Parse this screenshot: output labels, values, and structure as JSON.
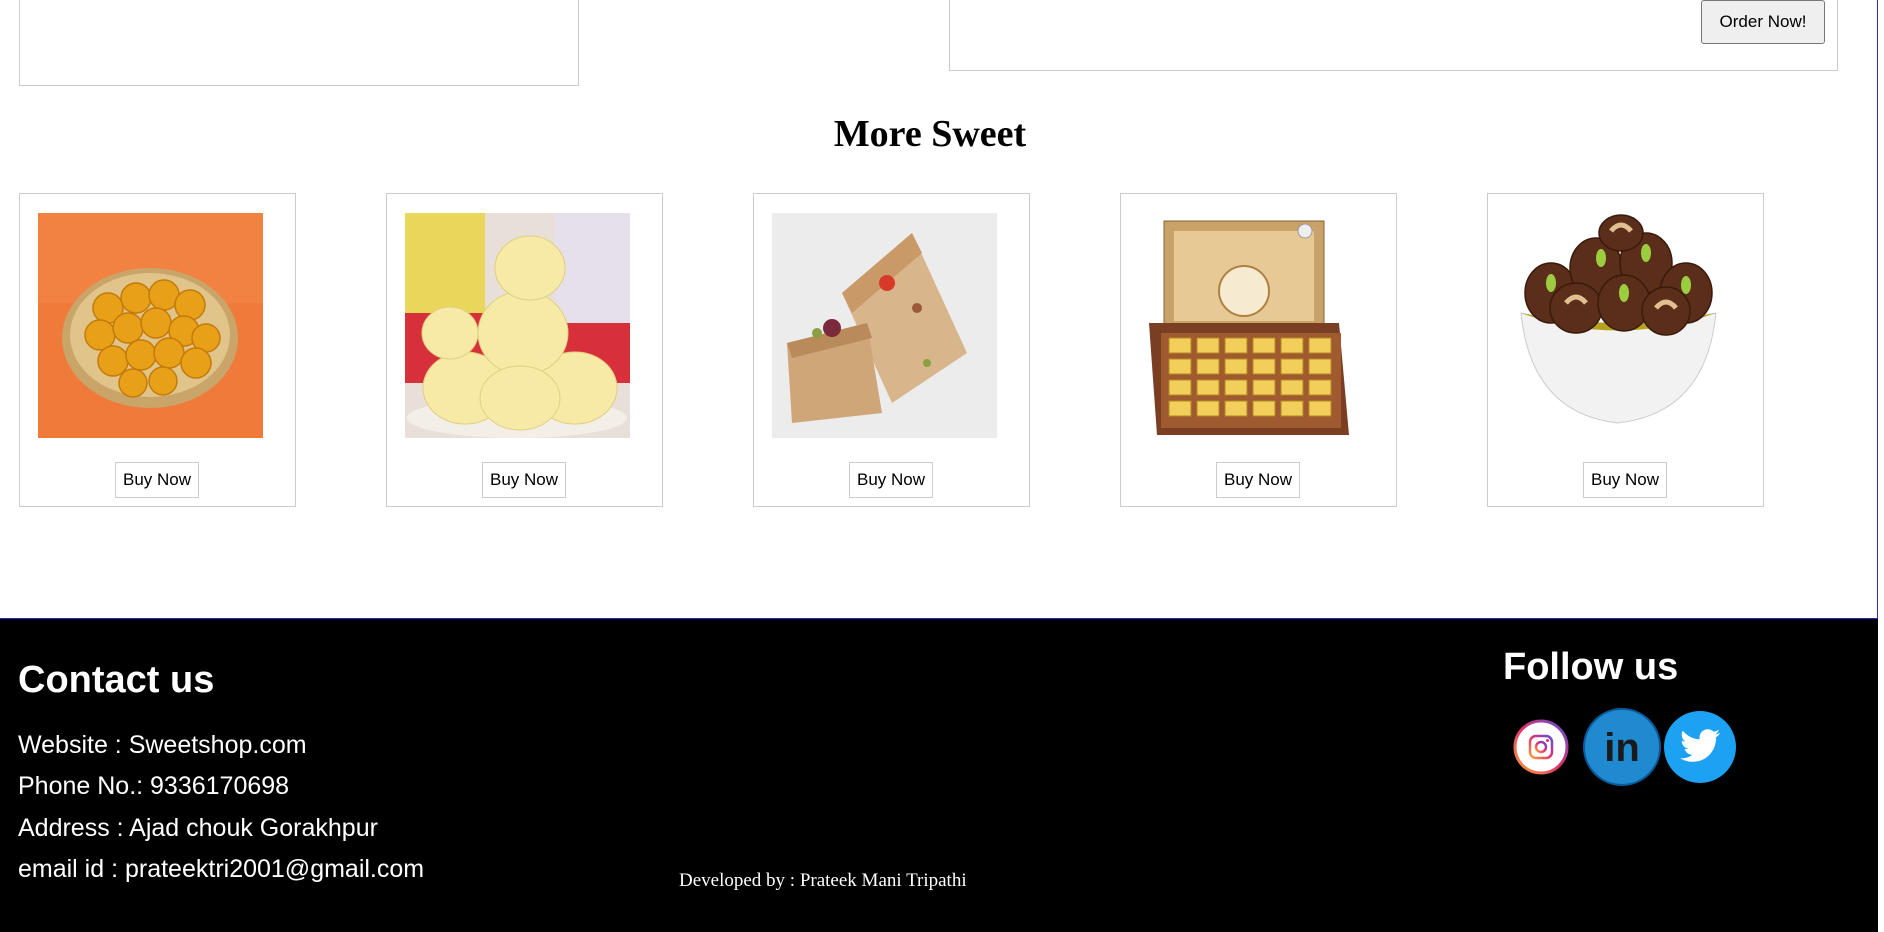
{
  "order_button": {
    "label": "Order Now!"
  },
  "more_sweet": {
    "title": "More Sweet",
    "items": [
      {
        "name": "laddu",
        "button": "Buy Now"
      },
      {
        "name": "rasgulla",
        "button": "Buy Now"
      },
      {
        "name": "milk-cake",
        "button": "Buy Now"
      },
      {
        "name": "chocolate-box",
        "button": "Buy Now"
      },
      {
        "name": "dry-fruit-sweets",
        "button": "Buy Now"
      }
    ]
  },
  "footer": {
    "contact_title": "Contact us",
    "website": "Website : Sweetshop.com",
    "phone": "Phone No.: 9336170698",
    "address": "Address : Ajad chouk Gorakhpur",
    "email": "email id : prateektri2001@gmail.com",
    "developed_by": "Developed by : Prateek Mani Tripathi",
    "follow_title": "Follow us",
    "social": [
      "instagram-icon",
      "linkedin-icon",
      "twitter-icon"
    ]
  },
  "colors": {
    "footer_bg": "#000000",
    "linkedin": "#1f8ad0",
    "twitter": "#1da1f2"
  }
}
